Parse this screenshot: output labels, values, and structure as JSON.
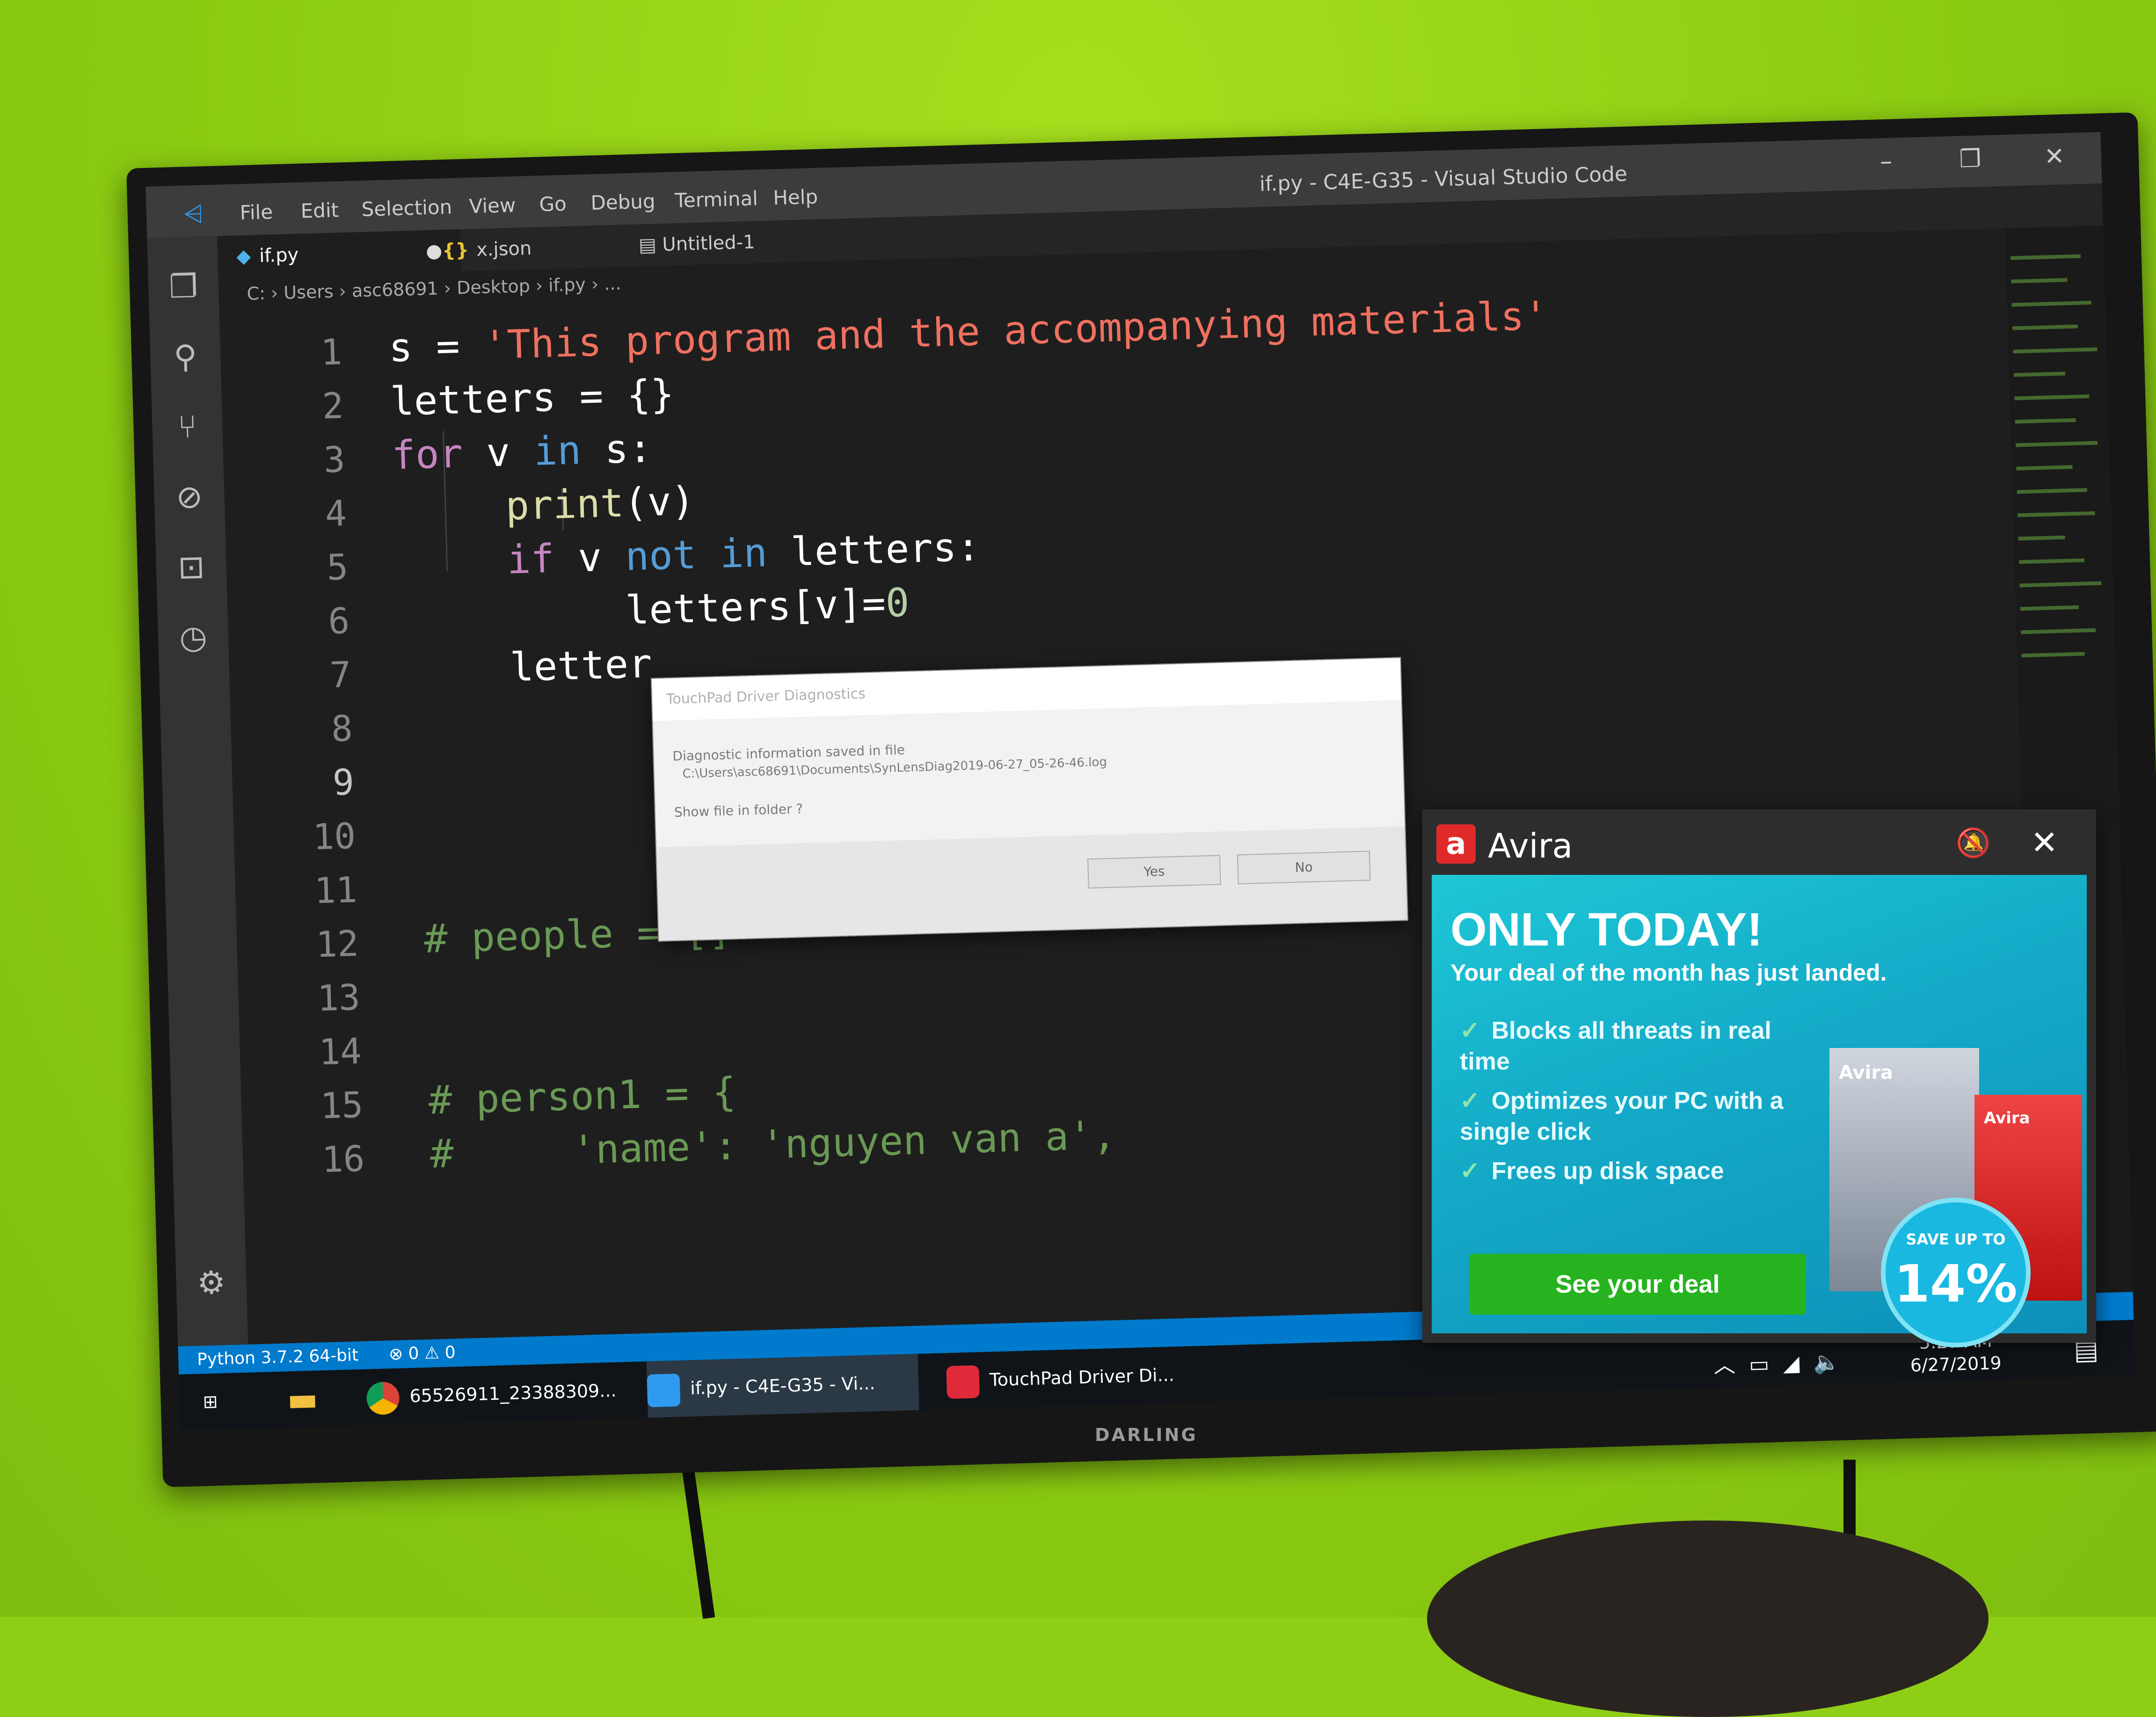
{
  "window": {
    "title": "if.py - C4E-G35 - Visual Studio Code"
  },
  "menu": [
    "File",
    "Edit",
    "Selection",
    "View",
    "Go",
    "Debug",
    "Terminal",
    "Help"
  ],
  "tabs": [
    {
      "label": "if.py",
      "active": true
    },
    {
      "label": "x.json",
      "active": false
    },
    {
      "label": "Untitled-1",
      "active": false
    }
  ],
  "breadcrumb": "C: › Users › asc68691 › Desktop › if.py › ...",
  "code_lines": [
    {
      "n": "1",
      "text": "s = 'This program and the accompanying materials'"
    },
    {
      "n": "2",
      "text": "letters = {}"
    },
    {
      "n": "3",
      "text": "for v in s:"
    },
    {
      "n": "4",
      "text": "print(v)"
    },
    {
      "n": "5",
      "text": "if v not in letters:"
    },
    {
      "n": "6",
      "text": "letters[v]=0"
    },
    {
      "n": "7",
      "text": "letter"
    },
    {
      "n": "8",
      "text": ""
    },
    {
      "n": "9",
      "text": ""
    },
    {
      "n": "10",
      "text": ""
    },
    {
      "n": "11",
      "text": ""
    },
    {
      "n": "12",
      "text": "# people = []"
    },
    {
      "n": "13",
      "text": ""
    },
    {
      "n": "14",
      "text": ""
    },
    {
      "n": "15",
      "text": "# person1 = {"
    },
    {
      "n": "16",
      "text": "#     'name': 'nguyen van a',"
    }
  ],
  "status": {
    "python": "Python 3.7.2 64-bit",
    "problems": "⊗ 0 ⚠ 0"
  },
  "dialog": {
    "title": "TouchPad Driver Diagnostics",
    "message_line1": "Diagnostic information saved in file",
    "message_line2": "C:\\Users\\asc68691\\Documents\\SynLensDiag2019-06-27_05-26-46.log",
    "question": "Show file in folder ?",
    "yes": "Yes",
    "no": "No"
  },
  "avira": {
    "brand": "Avira",
    "headline": "ONLY TODAY!",
    "subline": "Your deal of the month has just landed.",
    "bullets": [
      "Blocks all threats in real time",
      "Optimizes your PC with a single click",
      "Frees up disk space"
    ],
    "cta": "See your deal",
    "badge_top": "SAVE UP TO",
    "badge_pct": "14%",
    "box1": "Avira",
    "box2": "Avira"
  },
  "taskbar": {
    "chrome": "65526911_23388309...",
    "vscode": "if.py - C4E-G35 - Vi...",
    "touchpad": "TouchPad Driver Di...",
    "time": "5:27 AM",
    "date": "6/27/2019"
  },
  "tv_brand": "DARLING",
  "colors": {
    "wall": "#8fce16",
    "accent": "#007acc",
    "avira_red": "#e02a2a",
    "cta_green": "#26b31f"
  }
}
